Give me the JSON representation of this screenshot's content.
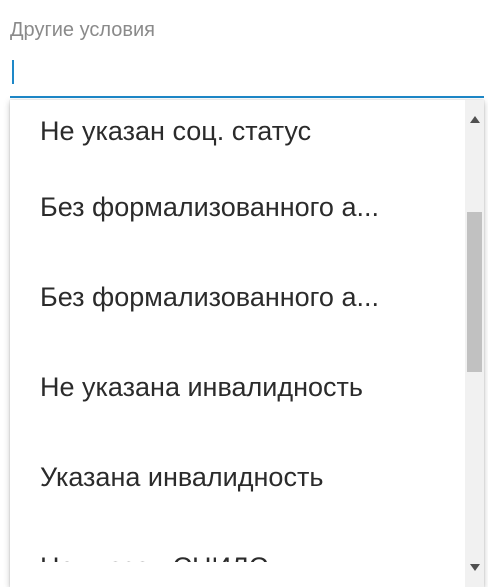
{
  "field": {
    "label": "Другие условия",
    "value": "",
    "placeholder": ""
  },
  "colors": {
    "accent": "#1e88c8",
    "label": "#8a8a8a",
    "text": "#2b2b2b"
  },
  "menu": {
    "items": [
      {
        "label": "Не указан соц. статус"
      },
      {
        "label": "Без формализованного а..."
      },
      {
        "label": "Без формализованного а..."
      },
      {
        "label": "Не указана инвалидность"
      },
      {
        "label": "Указана инвалидность"
      },
      {
        "label": "Не указан СНИЛС"
      }
    ]
  },
  "icons": {
    "dropdown": "chevron-down-icon",
    "scroll_up": "scroll-up-arrow-icon",
    "scroll_down": "scroll-down-arrow-icon"
  }
}
